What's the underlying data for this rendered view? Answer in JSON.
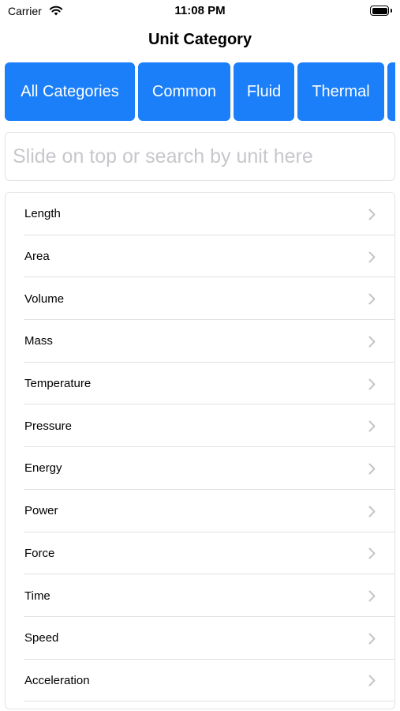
{
  "status_bar": {
    "carrier": "Carrier",
    "time": "11:08 PM",
    "icons": [
      "wifi-icon",
      "battery-icon"
    ]
  },
  "nav": {
    "title": "Unit Category"
  },
  "categories": [
    {
      "label": "All Categories"
    },
    {
      "label": "Common"
    },
    {
      "label": "Fluid"
    },
    {
      "label": "Thermal"
    },
    {
      "label": ""
    }
  ],
  "search": {
    "placeholder": "Slide on top or search by unit here",
    "value": ""
  },
  "list": {
    "items": [
      {
        "label": "Length"
      },
      {
        "label": "Area"
      },
      {
        "label": "Volume"
      },
      {
        "label": "Mass"
      },
      {
        "label": "Temperature"
      },
      {
        "label": "Pressure"
      },
      {
        "label": "Energy"
      },
      {
        "label": "Power"
      },
      {
        "label": "Force"
      },
      {
        "label": "Time"
      },
      {
        "label": "Speed"
      },
      {
        "label": "Acceleration"
      }
    ],
    "row_icon": "chevron-right-icon"
  },
  "colors": {
    "accent": "#1a7ff9",
    "placeholder": "#c7c7cc",
    "separator": "#e0e0e3",
    "chevron": "#c4c4c7"
  }
}
